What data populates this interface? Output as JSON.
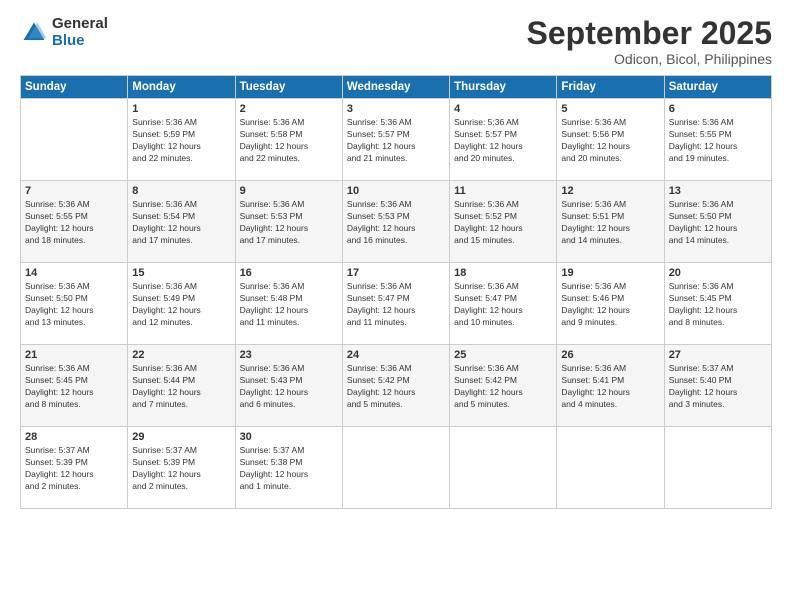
{
  "logo": {
    "general": "General",
    "blue": "Blue"
  },
  "title": "September 2025",
  "subtitle": "Odicon, Bicol, Philippines",
  "days_of_week": [
    "Sunday",
    "Monday",
    "Tuesday",
    "Wednesday",
    "Thursday",
    "Friday",
    "Saturday"
  ],
  "weeks": [
    [
      {
        "day": "",
        "info": ""
      },
      {
        "day": "1",
        "info": "Sunrise: 5:36 AM\nSunset: 5:59 PM\nDaylight: 12 hours\nand 22 minutes."
      },
      {
        "day": "2",
        "info": "Sunrise: 5:36 AM\nSunset: 5:58 PM\nDaylight: 12 hours\nand 22 minutes."
      },
      {
        "day": "3",
        "info": "Sunrise: 5:36 AM\nSunset: 5:57 PM\nDaylight: 12 hours\nand 21 minutes."
      },
      {
        "day": "4",
        "info": "Sunrise: 5:36 AM\nSunset: 5:57 PM\nDaylight: 12 hours\nand 20 minutes."
      },
      {
        "day": "5",
        "info": "Sunrise: 5:36 AM\nSunset: 5:56 PM\nDaylight: 12 hours\nand 20 minutes."
      },
      {
        "day": "6",
        "info": "Sunrise: 5:36 AM\nSunset: 5:55 PM\nDaylight: 12 hours\nand 19 minutes."
      }
    ],
    [
      {
        "day": "7",
        "info": "Sunrise: 5:36 AM\nSunset: 5:55 PM\nDaylight: 12 hours\nand 18 minutes."
      },
      {
        "day": "8",
        "info": "Sunrise: 5:36 AM\nSunset: 5:54 PM\nDaylight: 12 hours\nand 17 minutes."
      },
      {
        "day": "9",
        "info": "Sunrise: 5:36 AM\nSunset: 5:53 PM\nDaylight: 12 hours\nand 17 minutes."
      },
      {
        "day": "10",
        "info": "Sunrise: 5:36 AM\nSunset: 5:53 PM\nDaylight: 12 hours\nand 16 minutes."
      },
      {
        "day": "11",
        "info": "Sunrise: 5:36 AM\nSunset: 5:52 PM\nDaylight: 12 hours\nand 15 minutes."
      },
      {
        "day": "12",
        "info": "Sunrise: 5:36 AM\nSunset: 5:51 PM\nDaylight: 12 hours\nand 14 minutes."
      },
      {
        "day": "13",
        "info": "Sunrise: 5:36 AM\nSunset: 5:50 PM\nDaylight: 12 hours\nand 14 minutes."
      }
    ],
    [
      {
        "day": "14",
        "info": "Sunrise: 5:36 AM\nSunset: 5:50 PM\nDaylight: 12 hours\nand 13 minutes."
      },
      {
        "day": "15",
        "info": "Sunrise: 5:36 AM\nSunset: 5:49 PM\nDaylight: 12 hours\nand 12 minutes."
      },
      {
        "day": "16",
        "info": "Sunrise: 5:36 AM\nSunset: 5:48 PM\nDaylight: 12 hours\nand 11 minutes."
      },
      {
        "day": "17",
        "info": "Sunrise: 5:36 AM\nSunset: 5:47 PM\nDaylight: 12 hours\nand 11 minutes."
      },
      {
        "day": "18",
        "info": "Sunrise: 5:36 AM\nSunset: 5:47 PM\nDaylight: 12 hours\nand 10 minutes."
      },
      {
        "day": "19",
        "info": "Sunrise: 5:36 AM\nSunset: 5:46 PM\nDaylight: 12 hours\nand 9 minutes."
      },
      {
        "day": "20",
        "info": "Sunrise: 5:36 AM\nSunset: 5:45 PM\nDaylight: 12 hours\nand 8 minutes."
      }
    ],
    [
      {
        "day": "21",
        "info": "Sunrise: 5:36 AM\nSunset: 5:45 PM\nDaylight: 12 hours\nand 8 minutes."
      },
      {
        "day": "22",
        "info": "Sunrise: 5:36 AM\nSunset: 5:44 PM\nDaylight: 12 hours\nand 7 minutes."
      },
      {
        "day": "23",
        "info": "Sunrise: 5:36 AM\nSunset: 5:43 PM\nDaylight: 12 hours\nand 6 minutes."
      },
      {
        "day": "24",
        "info": "Sunrise: 5:36 AM\nSunset: 5:42 PM\nDaylight: 12 hours\nand 5 minutes."
      },
      {
        "day": "25",
        "info": "Sunrise: 5:36 AM\nSunset: 5:42 PM\nDaylight: 12 hours\nand 5 minutes."
      },
      {
        "day": "26",
        "info": "Sunrise: 5:36 AM\nSunset: 5:41 PM\nDaylight: 12 hours\nand 4 minutes."
      },
      {
        "day": "27",
        "info": "Sunrise: 5:37 AM\nSunset: 5:40 PM\nDaylight: 12 hours\nand 3 minutes."
      }
    ],
    [
      {
        "day": "28",
        "info": "Sunrise: 5:37 AM\nSunset: 5:39 PM\nDaylight: 12 hours\nand 2 minutes."
      },
      {
        "day": "29",
        "info": "Sunrise: 5:37 AM\nSunset: 5:39 PM\nDaylight: 12 hours\nand 2 minutes."
      },
      {
        "day": "30",
        "info": "Sunrise: 5:37 AM\nSunset: 5:38 PM\nDaylight: 12 hours\nand 1 minute."
      },
      {
        "day": "",
        "info": ""
      },
      {
        "day": "",
        "info": ""
      },
      {
        "day": "",
        "info": ""
      },
      {
        "day": "",
        "info": ""
      }
    ]
  ]
}
